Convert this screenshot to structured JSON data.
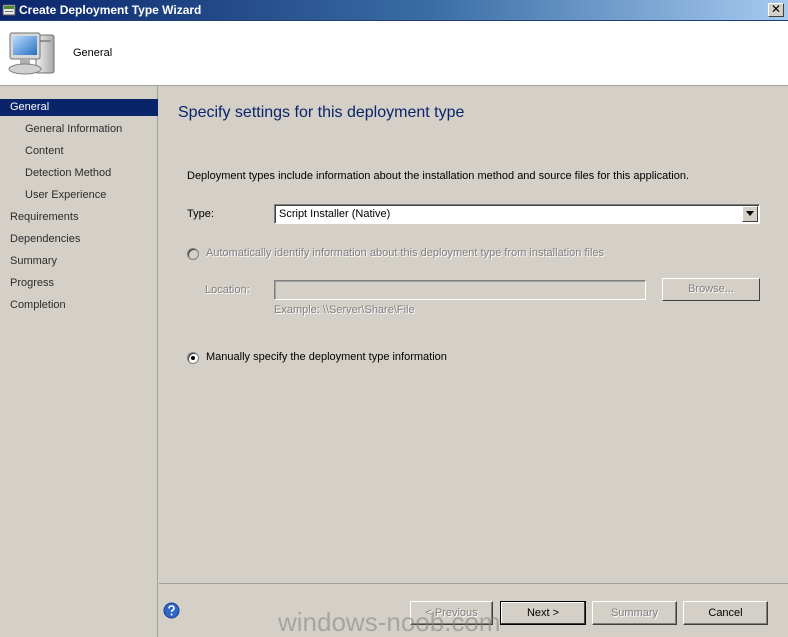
{
  "window": {
    "title": "Create Deployment Type Wizard",
    "close_glyph": "✕"
  },
  "header": {
    "label": "General",
    "icon": "computer-icon"
  },
  "sidebar": {
    "items": [
      {
        "label": "General",
        "level": 0,
        "active": true
      },
      {
        "label": "General Information",
        "level": 1,
        "active": false
      },
      {
        "label": "Content",
        "level": 1,
        "active": false
      },
      {
        "label": "Detection Method",
        "level": 1,
        "active": false
      },
      {
        "label": "User Experience",
        "level": 1,
        "active": false
      },
      {
        "label": "Requirements",
        "level": 0,
        "active": false
      },
      {
        "label": "Dependencies",
        "level": 0,
        "active": false
      },
      {
        "label": "Summary",
        "level": 0,
        "active": false
      },
      {
        "label": "Progress",
        "level": 0,
        "active": false
      },
      {
        "label": "Completion",
        "level": 0,
        "active": false
      }
    ]
  },
  "main": {
    "heading": "Specify settings for this deployment type",
    "description": "Deployment types include information about the installation method and source files for this application.",
    "type_label": "Type:",
    "type_value": "Script Installer (Native)",
    "auto_option": {
      "label": "Automatically identify information about this deployment type from installation files",
      "selected": false,
      "enabled": false
    },
    "location_label": "Location:",
    "location_value": "",
    "browse_label": "Browse...",
    "example": "Example: \\\\Server\\Share\\File",
    "manual_option": {
      "label": "Manually specify the deployment type information",
      "selected": true,
      "enabled": true
    }
  },
  "footer": {
    "previous_label": "< Previous",
    "next_label": "Next >",
    "summary_label": "Summary",
    "cancel_label": "Cancel"
  },
  "watermark": "windows-noob.com",
  "colors": {
    "accent": "#0a246a",
    "face": "#d4d0c8"
  }
}
